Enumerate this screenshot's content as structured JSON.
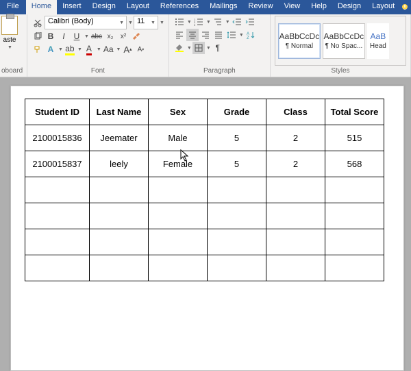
{
  "tabs": {
    "file": "File",
    "home": "Home",
    "insert": "Insert",
    "design1": "Design",
    "layout1": "Layout",
    "references": "References",
    "mailings": "Mailings",
    "review": "Review",
    "view": "View",
    "help": "Help",
    "design2": "Design",
    "layout2": "Layout"
  },
  "ribbon": {
    "clipboard": {
      "label": "oboard",
      "paste": "aste",
      "fmtpainter": "✂"
    },
    "font": {
      "label": "Font",
      "family": "Calibri (Body)",
      "size": "11",
      "bold": "B",
      "italic": "I",
      "underline": "U",
      "strike": "abc",
      "sub": "x₂",
      "sup": "x²",
      "clear": "✎",
      "effects": "A",
      "highlight": "ab",
      "color": "A",
      "casechg": "Aa",
      "grow": "A",
      "shrink": "A"
    },
    "paragraph": {
      "label": "Paragraph",
      "show": "¶"
    },
    "styles": {
      "label": "Styles",
      "preview": "AaBbCcDc",
      "normal": "¶ Normal",
      "nospace": "¶ No Spac...",
      "big": "AaB",
      "head": "Head"
    }
  },
  "table": {
    "headers": [
      "Student ID",
      "Last Name",
      "Sex",
      "Grade",
      "Class",
      "Total Score"
    ],
    "rows": [
      [
        "2100015836",
        "Jeemater",
        "Male",
        "5",
        "2",
        "515"
      ],
      [
        "2100015837",
        "leely",
        "Female",
        "5",
        "2",
        "568"
      ],
      [
        "",
        "",
        "",
        "",
        "",
        ""
      ],
      [
        "",
        "",
        "",
        "",
        "",
        ""
      ],
      [
        "",
        "",
        "",
        "",
        "",
        ""
      ],
      [
        "",
        "",
        "",
        "",
        "",
        ""
      ]
    ]
  }
}
